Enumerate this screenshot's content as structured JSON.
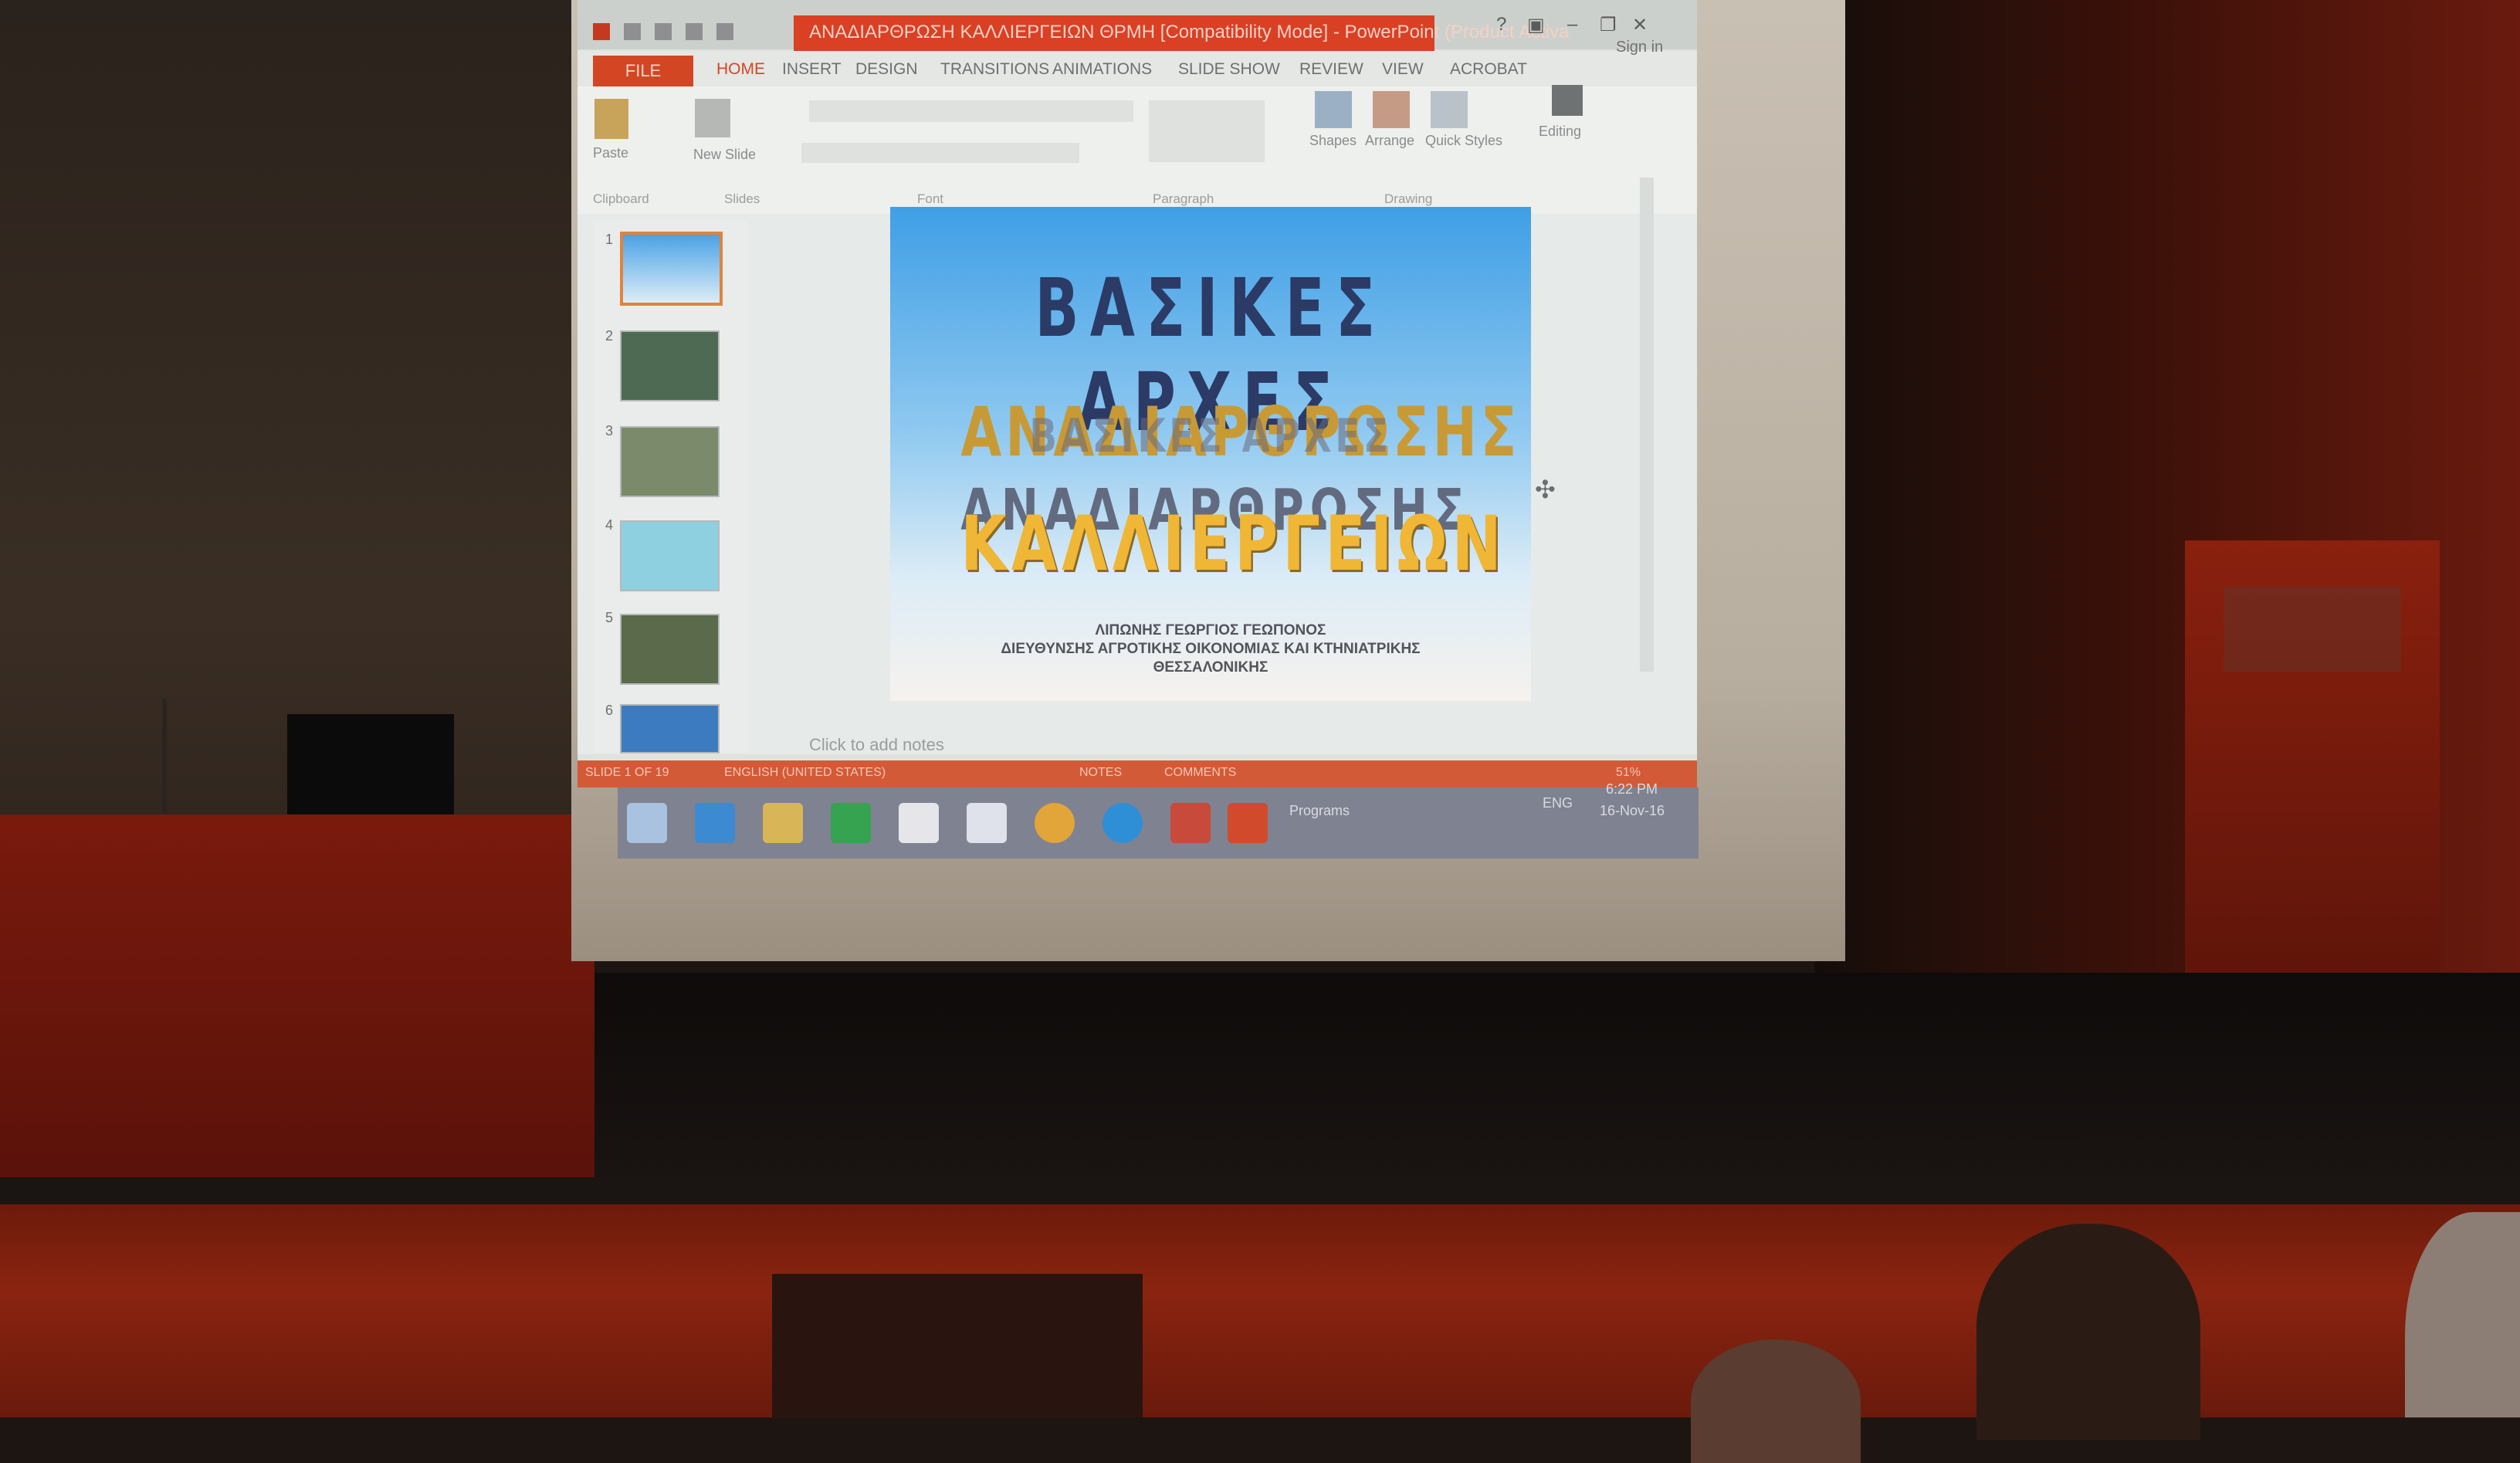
{
  "window": {
    "title": "ΑΝΑΔΙΑΡΘΡΩΣΗ ΚΑΛΛΙΕΡΓΕΙΩΝ ΘΡΜΗ [Compatibility Mode] - PowerPoint (Product Activa",
    "controls": [
      "?",
      "▣",
      "–",
      "❐",
      "✕"
    ],
    "sign_in": "Sign in"
  },
  "ribbon": {
    "file_tab": "FILE",
    "tabs": [
      "HOME",
      "INSERT",
      "DESIGN",
      "TRANSITIONS",
      "ANIMATIONS",
      "SLIDE SHOW",
      "REVIEW",
      "VIEW",
      "ACROBAT"
    ],
    "active_tab": "HOME",
    "buttons": {
      "paste": "Paste",
      "new_slide": "New Slide",
      "shapes": "Shapes",
      "arrange": "Arrange",
      "quick_styles": "Quick Styles",
      "editing": "Editing"
    },
    "groups": [
      "Clipboard",
      "Slides",
      "Font",
      "Paragraph",
      "Drawing"
    ]
  },
  "thumbnails": [
    "1",
    "2",
    "3",
    "4",
    "5",
    "6"
  ],
  "slide": {
    "title": "ΒΑΣΙΚΕΣ ΑΡΧΕΣ",
    "wordart_line1": "ΑΝΑΔΙΑΡΘΡΩΣΗΣ",
    "wordart_ghost": "ΒΑΣΙΚΕΣ ΑΡΧΕΣ",
    "wordart_line2": "ΑΝΑΔΙΑΡΘΡΩΣΗΣ",
    "wordart_line3": "ΚΑΛΛΙΕΡΓΕΙΩΝ",
    "author_line1": "ΛΙΠΩΝΗΣ ΓΕΩΡΓΙΟΣ ΓΕΩΠΟΝΟΣ",
    "author_line2": "ΔΙΕΥΘΥΝΣΗΣ ΑΓΡΟΤΙΚΗΣ ΟΙΚΟΝΟΜΙΑΣ ΚΑΙ ΚΤΗΝΙΑΤΡΙΚΗΣ",
    "author_line3": "ΘΕΣΣΑΛΟΝΙΚΗΣ"
  },
  "notes_placeholder": "Click to add notes",
  "status": {
    "slide_counter": "SLIDE 1 OF 19",
    "language": "ENGLISH (UNITED STATES)",
    "notes": "NOTES",
    "comments": "COMMENTS",
    "zoom": "51%"
  },
  "taskbar": {
    "programs": "Programs",
    "lang": "ENG",
    "time": "6:22 PM",
    "date": "16-Nov-16"
  },
  "colors": {
    "office_accent": "#d34623",
    "slide_title": "#2b3b66",
    "wordart_gold": "#f0b636",
    "slide_sky": "#3f9fe6"
  }
}
